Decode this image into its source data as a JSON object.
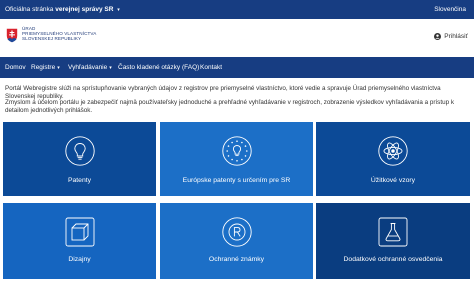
{
  "topbar": {
    "official_prefix": "Oficiálna stránka",
    "official_bold": "verejnej správy SR",
    "caret": "▾",
    "language": "Slovenčina"
  },
  "header": {
    "logo_line1": "ÚRAD",
    "logo_line2": "PRIEMYSELNÉHO VLASTNÍCTVA",
    "logo_line3": "SLOVENSKEJ REPUBLIKY",
    "login_label": "Prihlásiť"
  },
  "nav": {
    "items": [
      {
        "label": "Domov",
        "caret": ""
      },
      {
        "label": "Registre",
        "caret": "▾"
      },
      {
        "label": "Vyhľadávanie",
        "caret": "▾"
      },
      {
        "label": "Často kladené otázky (FAQ)",
        "caret": ""
      },
      {
        "label": "Kontakt",
        "caret": ""
      }
    ]
  },
  "intro": {
    "paragraph1": "Portál Webregistre slúži na sprístupňovanie vybraných údajov z registrov pre priemyselné vlastníctvo, ktoré vedie a spravuje Úrad priemyselného vlastníctva Slovenskej republiky.",
    "paragraph2": "Zmyslom a účelom portálu je zabezpečiť najmä používateľsky jednoduché a prehľadné vyhľadávanie v registroch, zobrazenie výsledkov vyhľadávania a prístup k detailom jednotlivých prihlášok."
  },
  "tiles": [
    {
      "label": "Patenty",
      "icon": "lightbulb-icon"
    },
    {
      "label": "Európske patenty s určením pre SR",
      "icon": "eu-lightbulb-icon"
    },
    {
      "label": "Úžitkové vzory",
      "icon": "atom-icon"
    },
    {
      "label": "Dizajny",
      "icon": "cube-icon"
    },
    {
      "label": "Ochranné známky",
      "icon": "registered-icon"
    },
    {
      "label": "Dodatkové ochranné osvedčenia",
      "icon": "flask-icon"
    }
  ],
  "colors": {
    "navy": "#173d82",
    "tile_dark": "#0c4a97",
    "tile_light": "#1c6fc7",
    "logo_red": "#d9232e"
  }
}
